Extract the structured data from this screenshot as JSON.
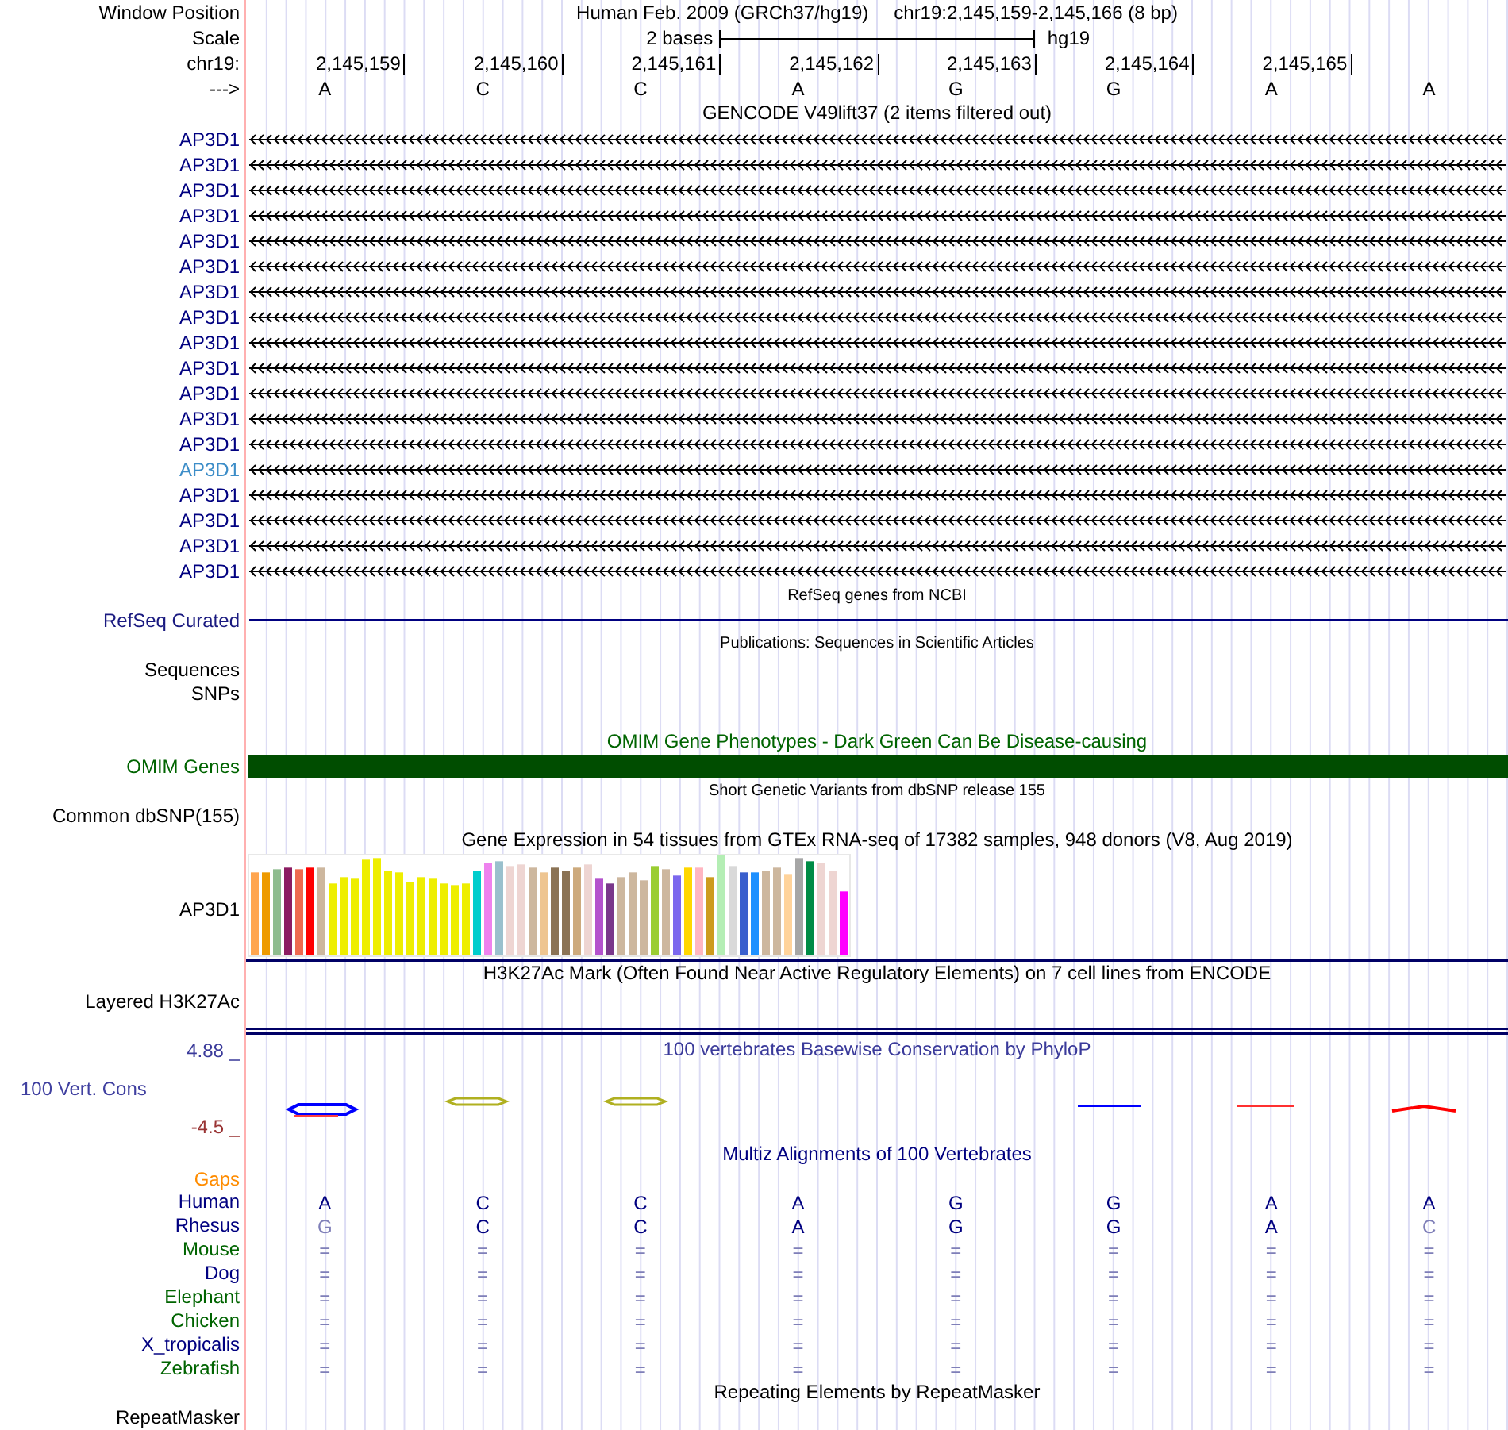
{
  "header": {
    "label": "Window Position",
    "assembly": "Human Feb. 2009 (GRCh37/hg19)",
    "position": "chr19:2,145,159-2,145,166 (8 bp)"
  },
  "scale": {
    "label": "Scale",
    "span": "2 bases",
    "database": "hg19"
  },
  "ruler": {
    "label": "chr19:",
    "positions": [
      "2,145,159",
      "2,145,160",
      "2,145,161",
      "2,145,162",
      "2,145,163",
      "2,145,164",
      "2,145,165"
    ]
  },
  "sequence": {
    "label": "--->",
    "bases": [
      "A",
      "C",
      "C",
      "A",
      "G",
      "G",
      "A",
      "A"
    ]
  },
  "tracks": [
    {
      "kind": "gene_list",
      "title": "GENCODE V49lift37 (2 items filtered out)",
      "items": [
        {
          "name": "AP3D1",
          "color": "#000080"
        },
        {
          "name": "AP3D1",
          "color": "#000080"
        },
        {
          "name": "AP3D1",
          "color": "#000080"
        },
        {
          "name": "AP3D1",
          "color": "#000080"
        },
        {
          "name": "AP3D1",
          "color": "#000080"
        },
        {
          "name": "AP3D1",
          "color": "#000080"
        },
        {
          "name": "AP3D1",
          "color": "#000080"
        },
        {
          "name": "AP3D1",
          "color": "#000080"
        },
        {
          "name": "AP3D1",
          "color": "#000080"
        },
        {
          "name": "AP3D1",
          "color": "#000080"
        },
        {
          "name": "AP3D1",
          "color": "#000080"
        },
        {
          "name": "AP3D1",
          "color": "#000080"
        },
        {
          "name": "AP3D1",
          "color": "#000080"
        },
        {
          "name": "AP3D1",
          "color": "#3c8dc8"
        },
        {
          "name": "AP3D1",
          "color": "#000080"
        },
        {
          "name": "AP3D1",
          "color": "#000080"
        },
        {
          "name": "AP3D1",
          "color": "#000080"
        },
        {
          "name": "AP3D1",
          "color": "#000080"
        }
      ]
    },
    {
      "kind": "line",
      "title": "RefSeq genes from NCBI",
      "label": "RefSeq Curated"
    },
    {
      "kind": "empty",
      "title": "Publications: Sequences in Scientific Articles",
      "labels": [
        "Sequences",
        "SNPs"
      ]
    },
    {
      "kind": "bar",
      "title": "OMIM Gene Phenotypes - Dark Green Can Be Disease-causing",
      "label": "OMIM Genes"
    },
    {
      "kind": "empty",
      "title": "Short Genetic Variants from dbSNP release 155",
      "labels": [
        "Common dbSNP(155)"
      ]
    },
    {
      "kind": "expression",
      "title": "Gene Expression in 54 tissues from GTEx RNA-seq of 17382 samples, 948 donors (V8, Aug 2019)",
      "label": "AP3D1"
    },
    {
      "kind": "empty",
      "title": "H3K27Ac Mark (Often Found Near Active Regulatory Elements) on 7 cell lines from ENCODE",
      "labels": [
        "Layered H3K27Ac"
      ]
    },
    {
      "kind": "conservation",
      "title": "100 vertebrates Basewise Conservation by PhyloP",
      "label": "100 Vert. Cons",
      "y_max": "4.88 _",
      "y_min": "-4.5 _"
    },
    {
      "kind": "alignment",
      "title": "Multiz Alignments of 100 Vertebrates",
      "gaps_label": "Gaps",
      "species": [
        {
          "name": "Human",
          "color": "#000080",
          "bases": [
            {
              "text": "A",
              "faded": false
            },
            {
              "text": "C",
              "faded": false
            },
            {
              "text": "C",
              "faded": false
            },
            {
              "text": "A",
              "faded": false
            },
            {
              "text": "G",
              "faded": false
            },
            {
              "text": "G",
              "faded": false
            },
            {
              "text": "A",
              "faded": false
            },
            {
              "text": "A",
              "faded": false
            }
          ]
        },
        {
          "name": "Rhesus",
          "color": "#000080",
          "bases": [
            {
              "text": "G",
              "faded": true
            },
            {
              "text": "C",
              "faded": false
            },
            {
              "text": "C",
              "faded": false
            },
            {
              "text": "A",
              "faded": false
            },
            {
              "text": "G",
              "faded": false
            },
            {
              "text": "G",
              "faded": false
            },
            {
              "text": "A",
              "faded": false
            },
            {
              "text": "C",
              "faded": true
            }
          ]
        },
        {
          "name": "Mouse",
          "color": "#006400",
          "bases": [
            {
              "text": "=",
              "faded": true
            },
            {
              "text": "=",
              "faded": true
            },
            {
              "text": "=",
              "faded": true
            },
            {
              "text": "=",
              "faded": true
            },
            {
              "text": "=",
              "faded": true
            },
            {
              "text": "=",
              "faded": true
            },
            {
              "text": "=",
              "faded": true
            },
            {
              "text": "=",
              "faded": true
            }
          ]
        },
        {
          "name": "Dog",
          "color": "#000080",
          "bases": [
            {
              "text": "=",
              "faded": true
            },
            {
              "text": "=",
              "faded": true
            },
            {
              "text": "=",
              "faded": true
            },
            {
              "text": "=",
              "faded": true
            },
            {
              "text": "=",
              "faded": true
            },
            {
              "text": "=",
              "faded": true
            },
            {
              "text": "=",
              "faded": true
            },
            {
              "text": "=",
              "faded": true
            }
          ]
        },
        {
          "name": "Elephant",
          "color": "#006400",
          "bases": [
            {
              "text": "=",
              "faded": true
            },
            {
              "text": "=",
              "faded": true
            },
            {
              "text": "=",
              "faded": true
            },
            {
              "text": "=",
              "faded": true
            },
            {
              "text": "=",
              "faded": true
            },
            {
              "text": "=",
              "faded": true
            },
            {
              "text": "=",
              "faded": true
            },
            {
              "text": "=",
              "faded": true
            }
          ]
        },
        {
          "name": "Chicken",
          "color": "#006400",
          "bases": [
            {
              "text": "=",
              "faded": true
            },
            {
              "text": "=",
              "faded": true
            },
            {
              "text": "=",
              "faded": true
            },
            {
              "text": "=",
              "faded": true
            },
            {
              "text": "=",
              "faded": true
            },
            {
              "text": "=",
              "faded": true
            },
            {
              "text": "=",
              "faded": true
            },
            {
              "text": "=",
              "faded": true
            }
          ]
        },
        {
          "name": "X_tropicalis",
          "color": "#000080",
          "bases": [
            {
              "text": "=",
              "faded": true
            },
            {
              "text": "=",
              "faded": true
            },
            {
              "text": "=",
              "faded": true
            },
            {
              "text": "=",
              "faded": true
            },
            {
              "text": "=",
              "faded": true
            },
            {
              "text": "=",
              "faded": true
            },
            {
              "text": "=",
              "faded": true
            },
            {
              "text": "=",
              "faded": true
            }
          ]
        },
        {
          "name": "Zebrafish",
          "color": "#006400",
          "bases": [
            {
              "text": "=",
              "faded": true
            },
            {
              "text": "=",
              "faded": true
            },
            {
              "text": "=",
              "faded": true
            },
            {
              "text": "=",
              "faded": true
            },
            {
              "text": "=",
              "faded": true
            },
            {
              "text": "=",
              "faded": true
            },
            {
              "text": "=",
              "faded": true
            },
            {
              "text": "=",
              "faded": true
            }
          ]
        }
      ]
    },
    {
      "kind": "empty",
      "title": "Repeating Elements by RepeatMasker",
      "labels": [
        "RepeatMasker"
      ]
    }
  ]
}
